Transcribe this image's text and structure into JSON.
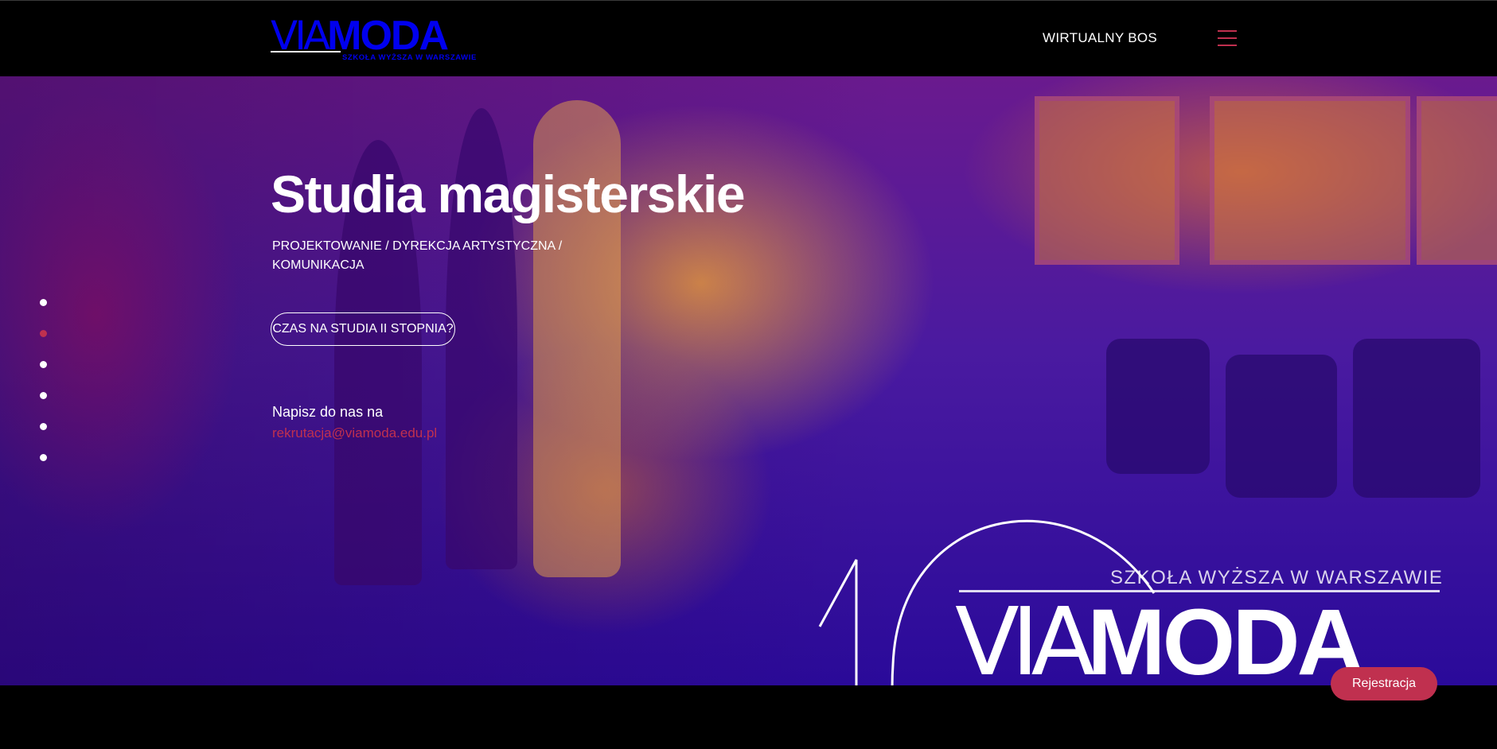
{
  "header": {
    "logo": {
      "via": "VIA",
      "moda": "MODA",
      "subtitle": "SZKOŁA WYŻSZA W WARSZAWIE"
    },
    "nav_link": "WIRTUALNY BOS",
    "menu_icon": "hamburger-menu-icon"
  },
  "hero": {
    "title": "Studia magisterskie",
    "subtitle_line1": "PROJEKTOWANIE / DYREKCJA ARTYSTYCZNA /",
    "subtitle_line2": "KOMUNIKACJA",
    "cta_label": "CZAS NA STUDIA II STOPNIA?",
    "contact_label": "Napisz do nas na",
    "contact_email": "rekrutacja@viamoda.edu.pl"
  },
  "slider": {
    "dot_count": 6,
    "active_index": 1
  },
  "emblem": {
    "subtitle": "SZKOŁA WYŻSZA W WARSZAWIE",
    "via": "VIA",
    "moda": "MODA"
  },
  "floating_button": {
    "label": "Rejestracja"
  },
  "colors": {
    "accent": "#c0304f",
    "header_bg": "#000000",
    "hero_tint": "#4a1aa0"
  }
}
